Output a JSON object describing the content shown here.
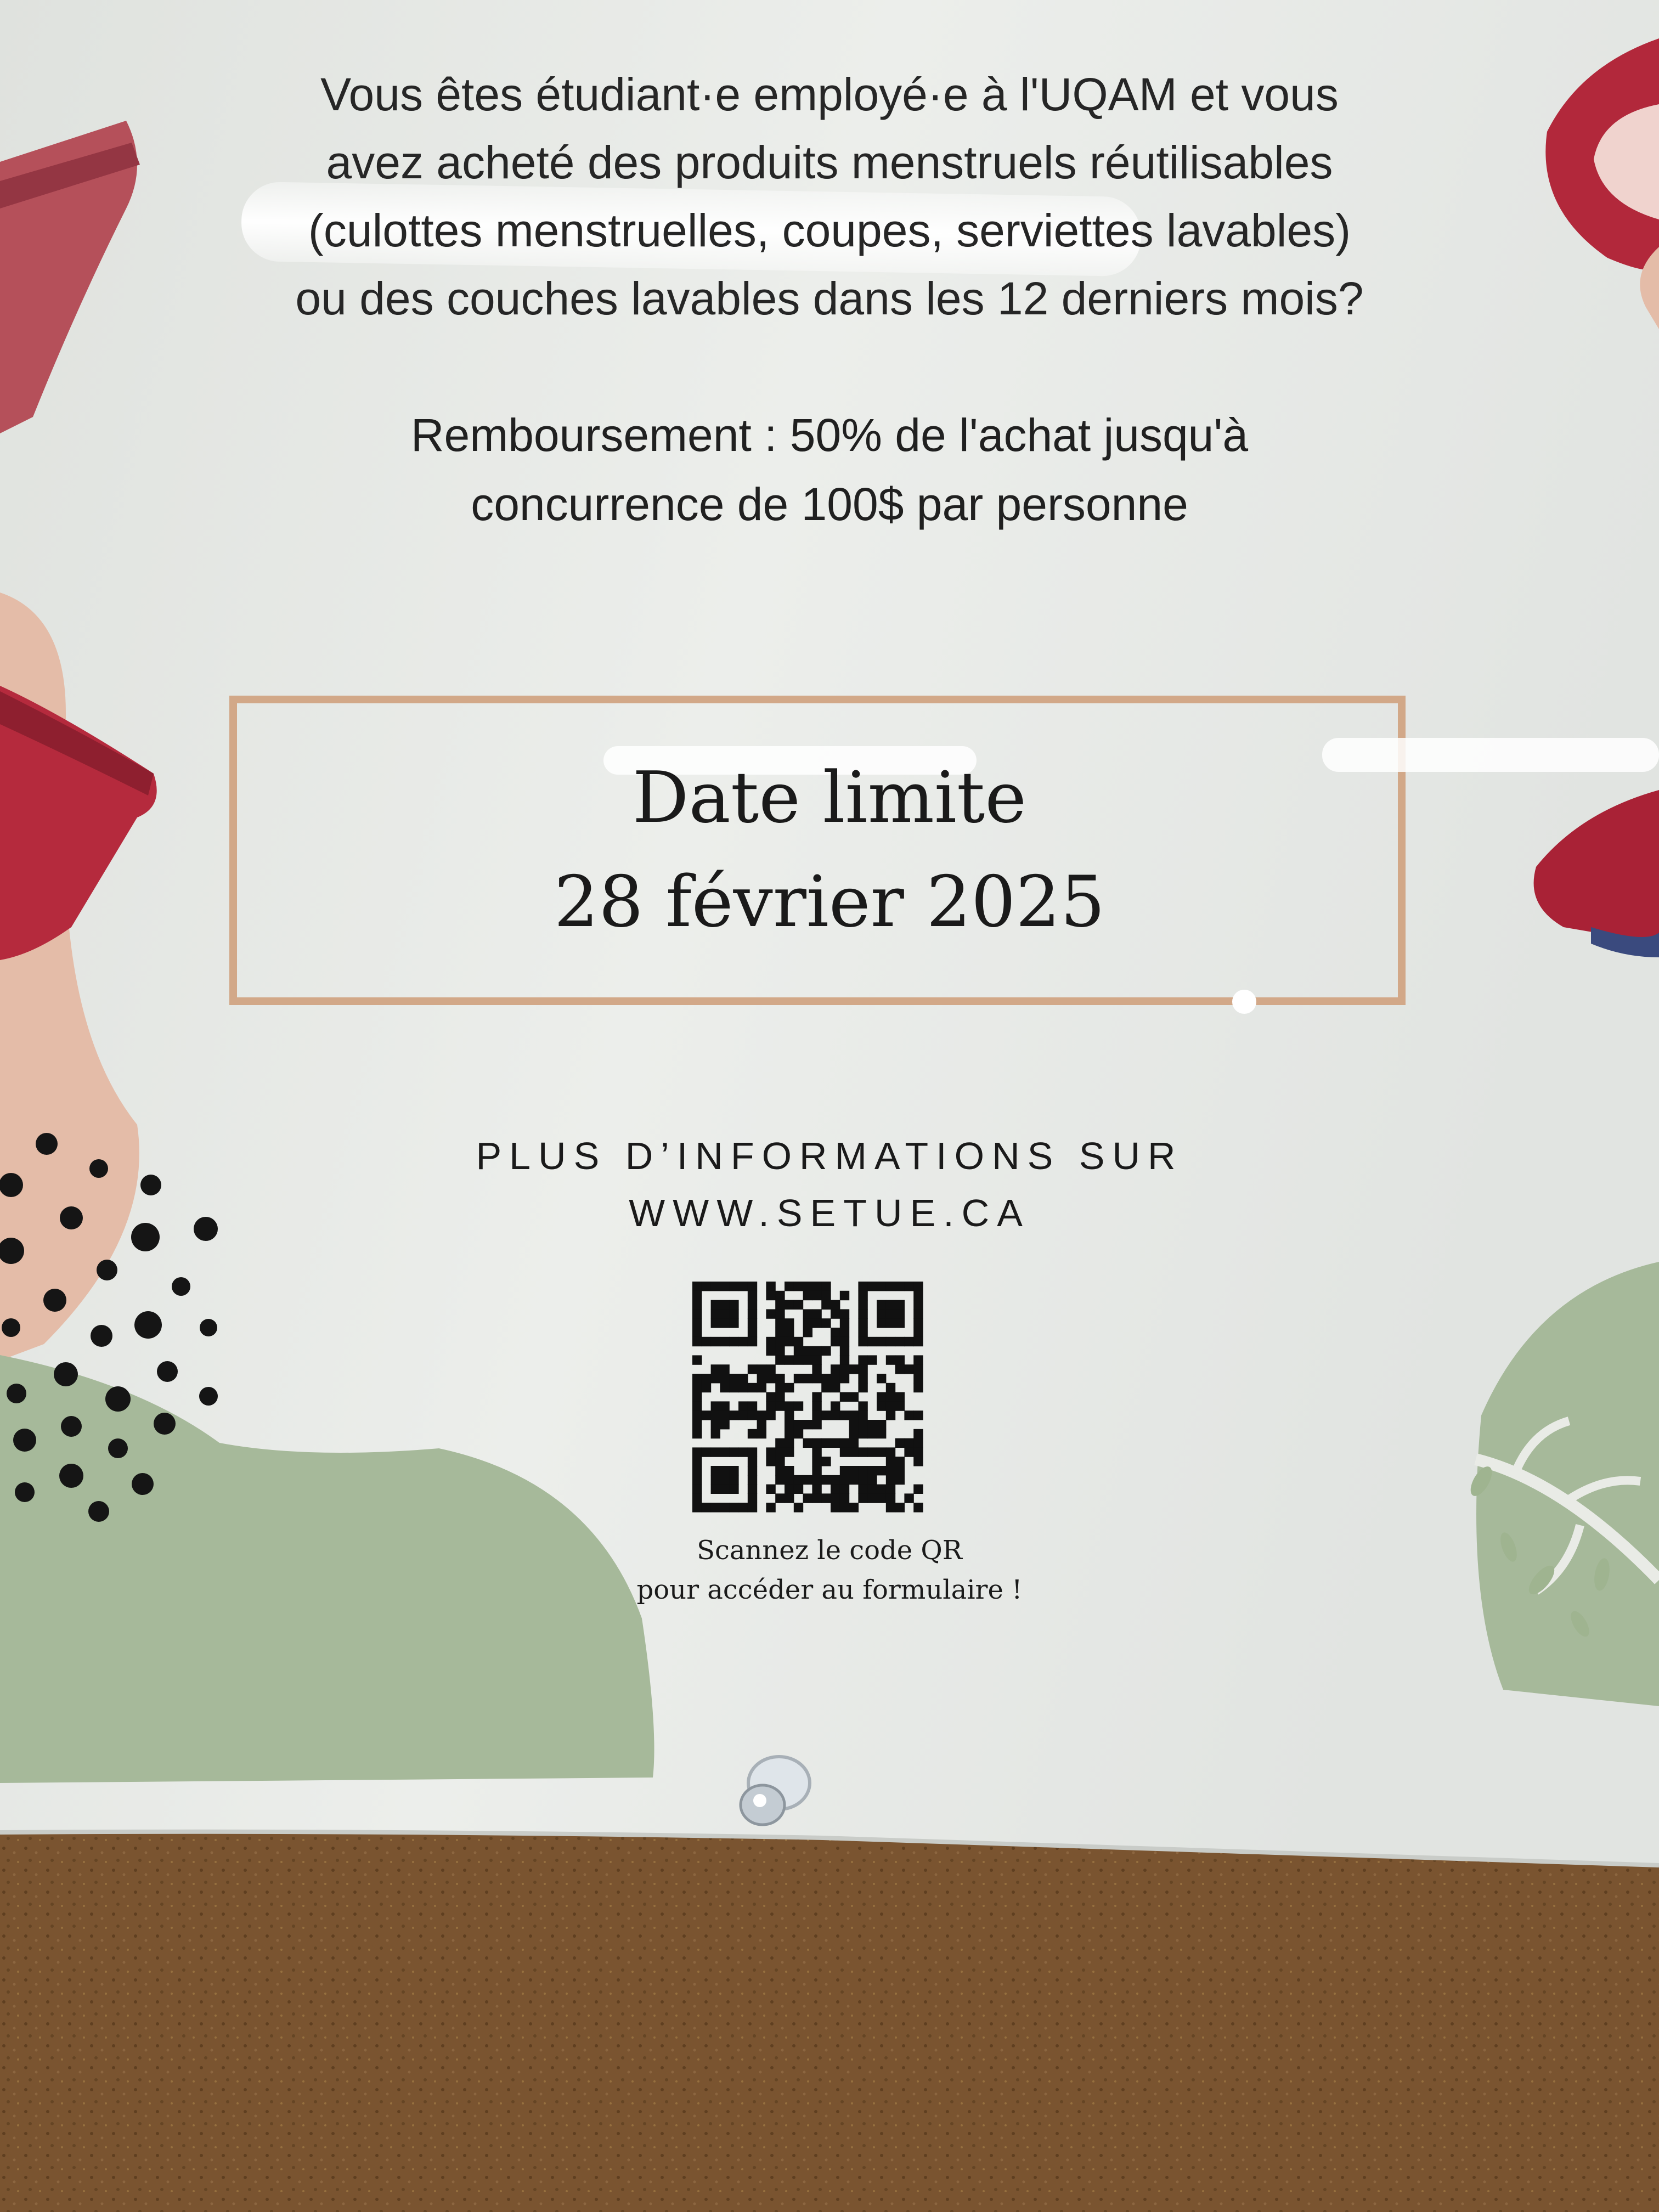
{
  "poster": {
    "intro_lines": [
      "Vous êtes étudiant·e employé·e à l'UQAM et vous",
      "avez acheté des produits menstruels réutilisables",
      "(culottes menstruelles, coupes, serviettes lavables)",
      "ou des couches lavables dans les 12 derniers mois?"
    ],
    "refund_lines": [
      "Remboursement : 50% de l'achat jusqu'à",
      "concurrence de 100$ par personne"
    ],
    "deadline_label": "Date limite",
    "deadline_date": "28 février 2025",
    "more_info_line1": "PLUS D’INFORMATIONS SUR",
    "more_info_url": "WWW.SETUE.CA",
    "qr_caption_line1": "Scannez le code QR",
    "qr_caption_line2": "pour accéder au formulaire !",
    "icons": [
      "menstrual-underwear-icon",
      "menstrual-pad-icon",
      "menstrual-cup-icon",
      "qr-code",
      "pushpin"
    ],
    "colors": {
      "paper": "#e6e8e5",
      "corkboard": "#7a5430",
      "deadline_border": "#d2a888",
      "accent_red": "#b02a3a",
      "accent_green": "#a7bb9b",
      "accent_skin": "#e2b9a4"
    }
  }
}
